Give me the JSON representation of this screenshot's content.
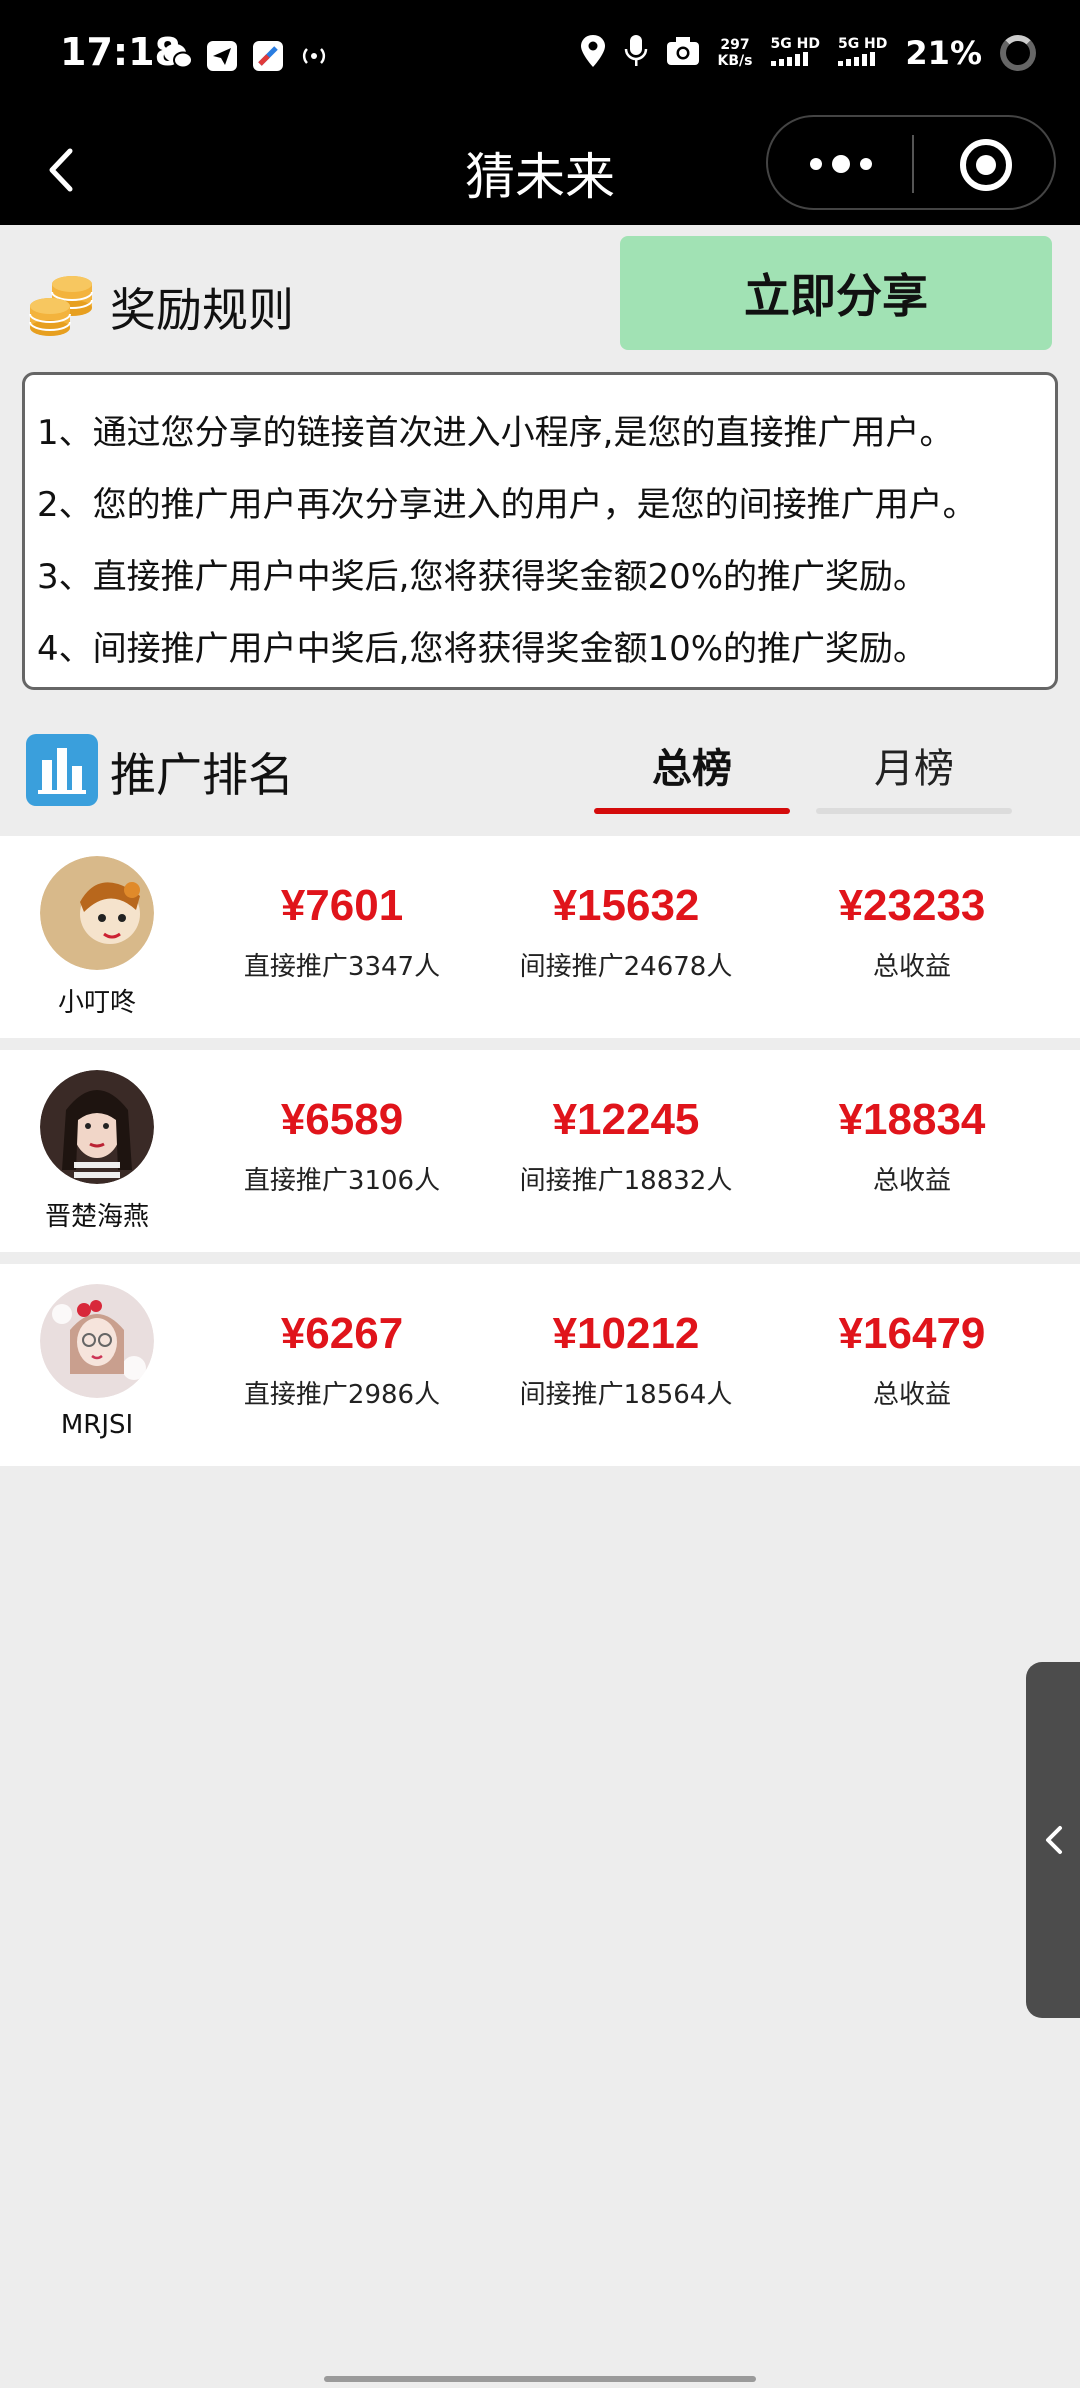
{
  "status_bar": {
    "time": "17:18",
    "net_speed": "297",
    "net_unit": "KB/s",
    "signal1": "5G HD",
    "signal2": "5G HD",
    "battery": "21%"
  },
  "nav": {
    "title": "猜未来"
  },
  "rules": {
    "title": "奖励规则",
    "share_button": "立即分享",
    "lines": [
      "1、通过您分享的链接首次进入小程序,是您的直接推广用户。",
      "2、您的推广用户再次分享进入的用户，是您的间接推广用户。",
      "3、直接推广用户中奖后,您将获得奖金额20%的推广奖励。",
      "4、间接推广用户中奖后,您将获得奖金额10%的推广奖励。"
    ]
  },
  "ranking": {
    "title": "推广排名",
    "tabs": [
      "总榜",
      "月榜"
    ],
    "active_tab": "总榜",
    "accent_color": "#e0141b",
    "rows": [
      {
        "name": "小叮咚",
        "direct_value": "¥7601",
        "direct_label": "直接推广3347人",
        "indirect_value": "¥15632",
        "indirect_label": "间接推广24678人",
        "total_value": "¥23233",
        "total_label": "总收益"
      },
      {
        "name": "晋楚海燕",
        "direct_value": "¥6589",
        "direct_label": "直接推广3106人",
        "indirect_value": "¥12245",
        "indirect_label": "间接推广18832人",
        "total_value": "¥18834",
        "total_label": "总收益"
      },
      {
        "name": "MRJSI",
        "direct_value": "¥6267",
        "direct_label": "直接推广2986人",
        "indirect_value": "¥10212",
        "indirect_label": "间接推广18564人",
        "total_value": "¥16479",
        "total_label": "总收益"
      }
    ]
  }
}
